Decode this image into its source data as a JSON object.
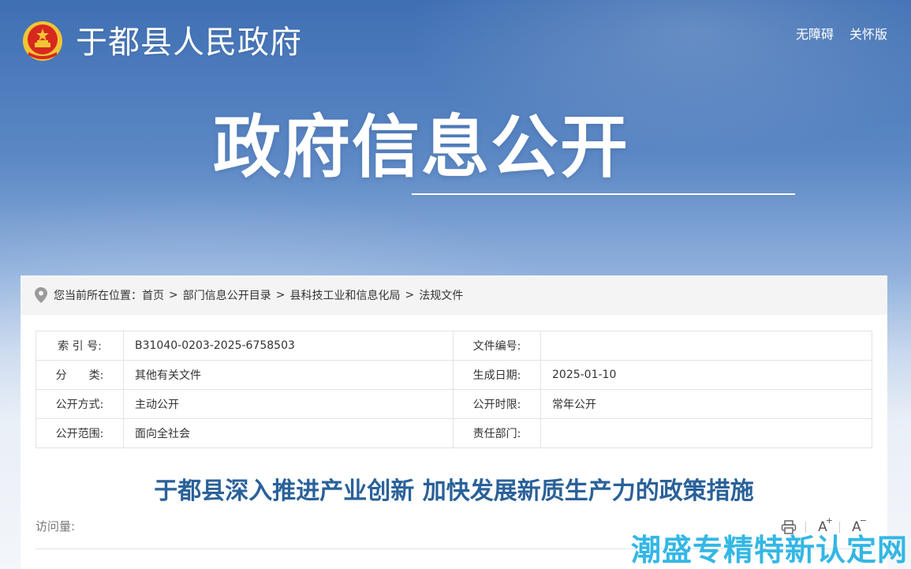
{
  "header": {
    "site_name": "于都县人民政府",
    "links": [
      "无障碍",
      "关怀版"
    ],
    "emblem_icon": "national-emblem-icon"
  },
  "banner": {
    "title": "政府信息公开"
  },
  "breadcrumb": {
    "label": "您当前所在位置：",
    "items": [
      "首页",
      "部门信息公开目录",
      "县科技工业和信息化局",
      "法规文件"
    ],
    "separator": ">"
  },
  "meta": {
    "rows": [
      {
        "l1": "索 引 号:",
        "v1": "B31040-0203-2025-6758503",
        "l2": "文件编号:",
        "v2": ""
      },
      {
        "l1": "分　　类:",
        "v1": "其他有关文件",
        "l2": "生成日期:",
        "v2": "2025-01-10"
      },
      {
        "l1": "公开方式:",
        "v1": "主动公开",
        "l2": "公开时限:",
        "v2": "常年公开"
      },
      {
        "l1": "公开范围:",
        "v1": "面向全社会",
        "l2": "责任部门:",
        "v2": ""
      }
    ]
  },
  "document": {
    "title": "于都县深入推进产业创新 加快发展新质生产力的政策措施",
    "visits_label": "访问量:",
    "font_up_label": "A",
    "font_up_sign": "+",
    "font_down_label": "A",
    "font_down_sign": "−"
  },
  "watermark": {
    "text": "潮盛专精特新认定网"
  },
  "colors": {
    "title_blue": "#2a6199",
    "watermark_blue": "#22b1e3",
    "emblem_red": "#d7281f",
    "emblem_gold": "#f2c434"
  }
}
